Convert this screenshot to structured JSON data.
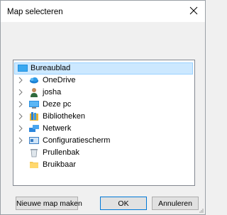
{
  "window": {
    "title": "Map selecteren"
  },
  "tree": {
    "items": [
      {
        "label": "Bureaublad",
        "icon": "desktop-icon",
        "expandable": false,
        "selected": true
      },
      {
        "label": "OneDrive",
        "icon": "onedrive-icon",
        "expandable": true,
        "selected": false
      },
      {
        "label": "josha",
        "icon": "user-icon",
        "expandable": true,
        "selected": false
      },
      {
        "label": "Deze pc",
        "icon": "computer-icon",
        "expandable": true,
        "selected": false
      },
      {
        "label": "Bibliotheken",
        "icon": "libraries-icon",
        "expandable": true,
        "selected": false
      },
      {
        "label": "Netwerk",
        "icon": "network-icon",
        "expandable": true,
        "selected": false
      },
      {
        "label": "Configuratiescherm",
        "icon": "control-panel-icon",
        "expandable": true,
        "selected": false
      },
      {
        "label": "Prullenbak",
        "icon": "recycle-bin-icon",
        "expandable": false,
        "selected": false
      },
      {
        "label": "Bruikbaar",
        "icon": "folder-icon",
        "expandable": false,
        "selected": false
      }
    ]
  },
  "buttons": {
    "new_folder": "Nieuwe map maken",
    "ok": "OK",
    "cancel": "Annuleren"
  },
  "colors": {
    "selection": "#cce8ff",
    "selection_border": "#99d1ff",
    "primary_border": "#0078d7"
  }
}
